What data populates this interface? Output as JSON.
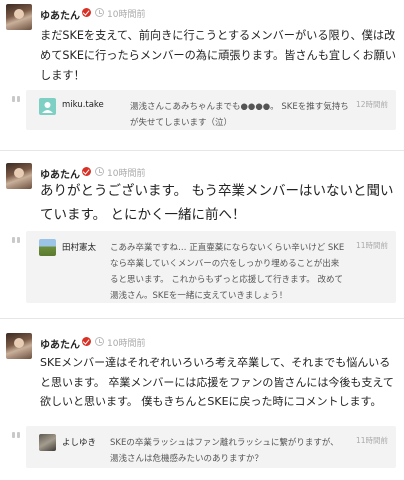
{
  "posts": [
    {
      "username": "ゆあたん",
      "time": "10時間前",
      "body": "まだSKEを支えて、前向きに行こうとするメンバーがいる限り、僕は改めてSKEに行ったらメンバーの為に頑張ります。皆さんも宜しくお願いします！",
      "reply": {
        "name": "miku.take",
        "text": "湯浅さんこあみちゃんまでも●●●●。 SKEを推す気持ちが失せてしまいます（泣）",
        "time": "12時間前"
      }
    },
    {
      "username": "ゆあたん",
      "time": "10時間前",
      "body": "ありがとうございます。 もう卒業メンバーはいないと聞いています。 とにかく一緒に前へ！",
      "reply": {
        "name": "田村憲太",
        "text": "こあみ卒業ですね… 正直壷薬にならないくらい辛いけど SKEなら卒業していくメンバーの穴をしっかり埋めることが出来ると思います。 これからもずっと応援して行きます。 改めて湯浅さん。SKEを一緒に支えていきましょう！",
        "time": "11時間前"
      }
    },
    {
      "username": "ゆあたん",
      "time": "10時間前",
      "body": "SKEメンバー達はそれぞれいろいろ考え卒業して、それまでも悩んいると思います。 卒業メンバーには応援をファンの皆さんには今後も支えて欲しいと思います。 僕もきちんとSKEに戻った時にコメントします。",
      "reply": {
        "name": "よしゆき",
        "text": "SKEの卒業ラッシュはファン離れラッシュに繋がりますが、湯浅さんは危機感みたいのありますか？",
        "time": "11時間前"
      }
    }
  ]
}
